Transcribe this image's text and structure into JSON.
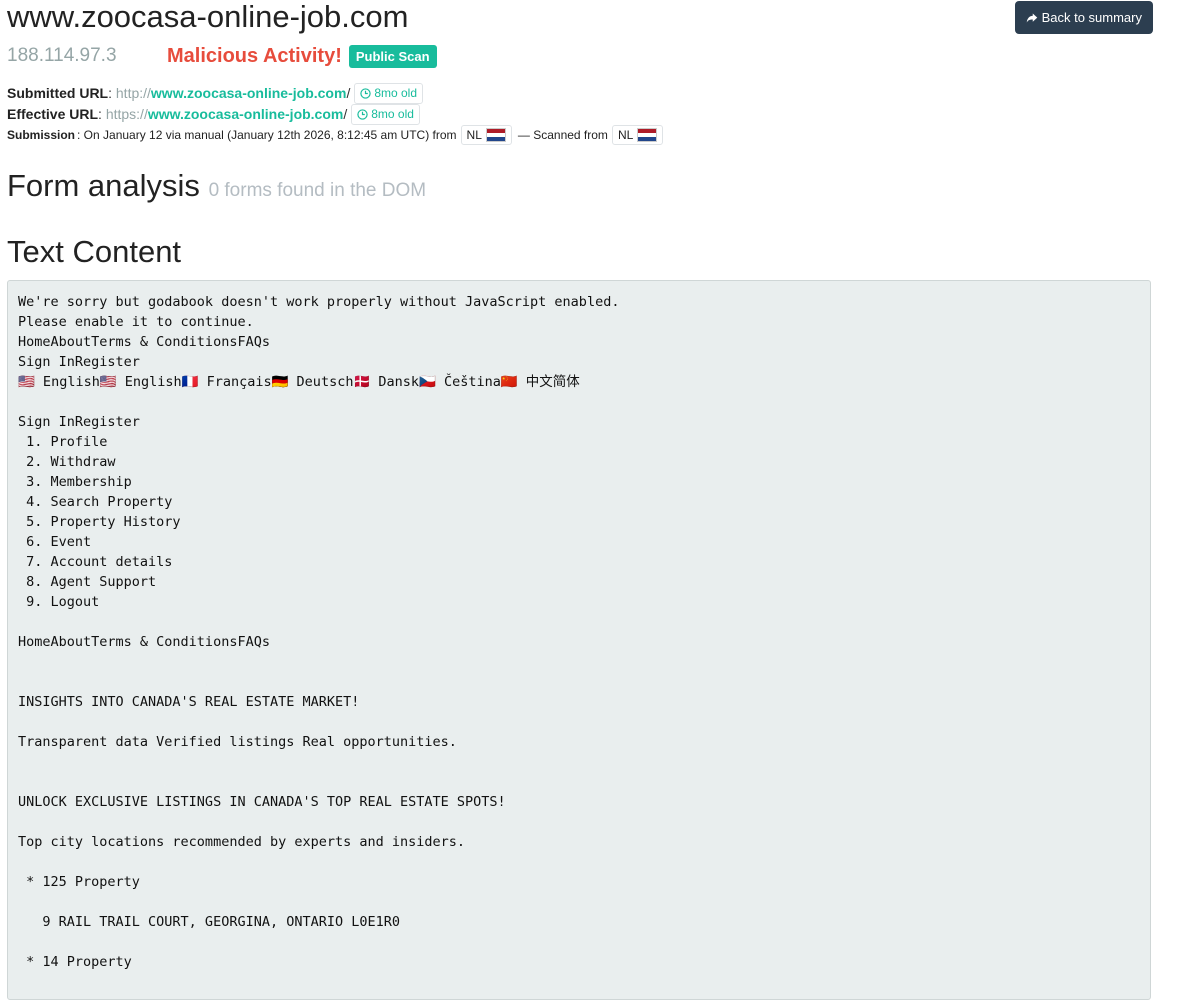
{
  "header": {
    "domain": "www.zoocasa-online-job.com",
    "ip": "188.114.97.3",
    "verdict": "Malicious Activity!",
    "scan_visibility": "Public Scan",
    "back_button": "Back to summary"
  },
  "submitted_url": {
    "label": "Submitted URL",
    "protocol": "http://",
    "host": "www.zoocasa-online-job.com",
    "path": "/",
    "age": "8mo old"
  },
  "effective_url": {
    "label": "Effective URL",
    "protocol": "https://",
    "host": "www.zoocasa-online-job.com",
    "path": "/",
    "age": "8mo old"
  },
  "submission": {
    "label": "Submission",
    "text": ": On January 12 via manual (January 12th 2026, 8:12:45 am UTC) from",
    "from_country": "NL",
    "scanned_text": "— Scanned from",
    "scanned_country": "NL"
  },
  "form_analysis": {
    "title": "Form analysis",
    "subtitle": "0 forms found in the DOM"
  },
  "text_content": {
    "title": "Text Content",
    "body": "We're sorry but godabook doesn't work properly without JavaScript enabled.\nPlease enable it to continue.\nHomeAboutTerms & ConditionsFAQs\nSign InRegister\n🇺🇸 English🇺🇸 English🇫🇷 Français🇩🇪 Deutsch🇩🇰 Dansk🇨🇿 Čeština🇨🇳 中文简体\n\nSign InRegister\n 1. Profile\n 2. Withdraw\n 3. Membership\n 4. Search Property\n 5. Property History\n 6. Event\n 7. Account details\n 8. Agent Support\n 9. Logout\n\nHomeAboutTerms & ConditionsFAQs\n\n\nINSIGHTS INTO CANADA'S REAL ESTATE MARKET!\n\nTransparent data Verified listings Real opportunities.\n\n\nUNLOCK EXCLUSIVE LISTINGS IN CANADA'S TOP REAL ESTATE SPOTS!\n\nTop city locations recommended by experts and insiders.\n\n * 125 Property\n\n   9 RAIL TRAIL COURT, GEORGINA, ONTARIO L0E1R0\n\n * 14 Property\n"
  },
  "colors": {
    "accent": "#18bc9c",
    "danger": "#e74c3c",
    "muted": "#95a5a6",
    "dark": "#2c3e50"
  }
}
